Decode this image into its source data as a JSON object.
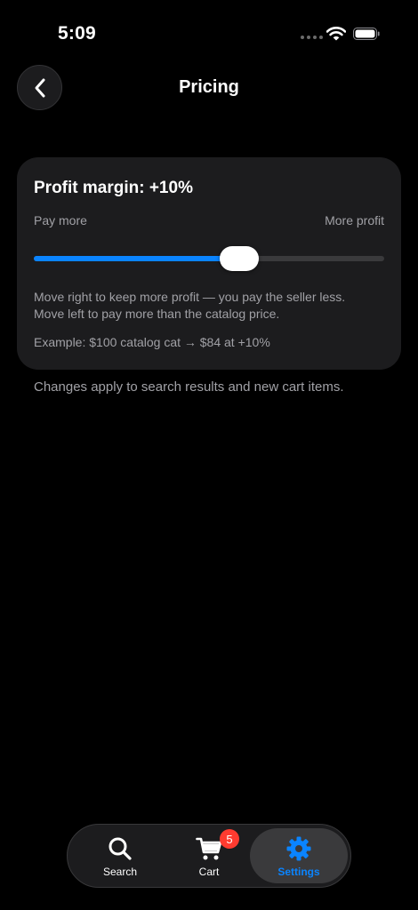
{
  "status_bar": {
    "time": "5:09"
  },
  "header": {
    "title": "Pricing",
    "back_icon": "chevron-left-icon"
  },
  "pricing_card": {
    "title": "Profit margin: +10%",
    "label_left": "Pay more",
    "label_right": "More profit",
    "slider_value": 0.587,
    "description_line1": "Move right to keep more profit — you pay the seller less.",
    "description_line2": "Move left to pay more than the catalog price.",
    "example": "Example: $100 catalog cat → $84 at +10%"
  },
  "footnote": "Changes apply to search results and new cart items.",
  "tab_bar": {
    "tabs": [
      {
        "label": "Search",
        "icon": "search-icon"
      },
      {
        "label": "Cart",
        "icon": "cart-icon",
        "badge": "5"
      },
      {
        "label": "Settings",
        "icon": "gear-icon",
        "active": true
      }
    ]
  },
  "colors": {
    "accent": "#0a84ff",
    "badge": "#ff3b30",
    "background": "#000000",
    "card": "#1c1c1e",
    "secondary_text": "#a1a1a6"
  }
}
